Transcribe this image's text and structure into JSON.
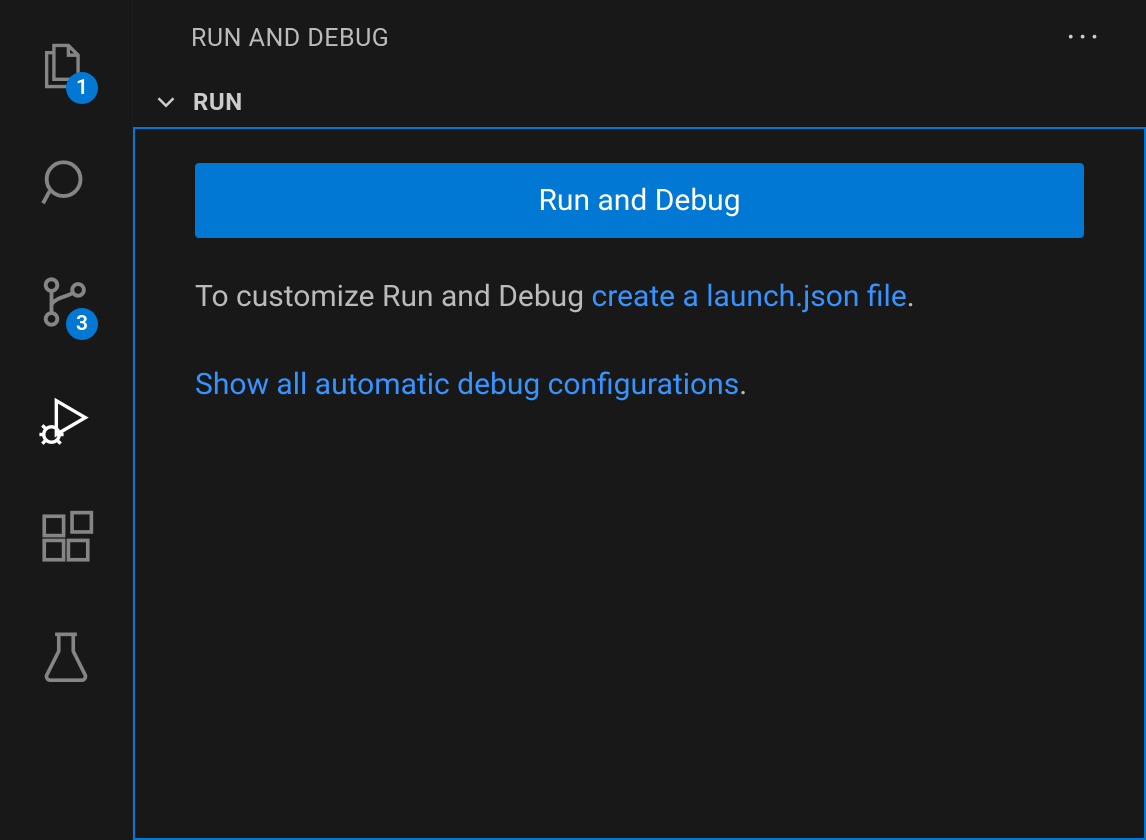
{
  "activityBar": {
    "explorer": {
      "badge": "1"
    },
    "scm": {
      "badge": "3"
    }
  },
  "sidebar": {
    "title": "RUN AND DEBUG",
    "section": {
      "title": "RUN",
      "buttonLabel": "Run and Debug",
      "customizeTextPrefix": "To customize Run and Debug ",
      "createLinkText": "create a launch.json file",
      "customizeTextSuffix": ".",
      "showAllLinkText": "Show all automatic debug configurations",
      "showAllSuffix": "."
    }
  }
}
